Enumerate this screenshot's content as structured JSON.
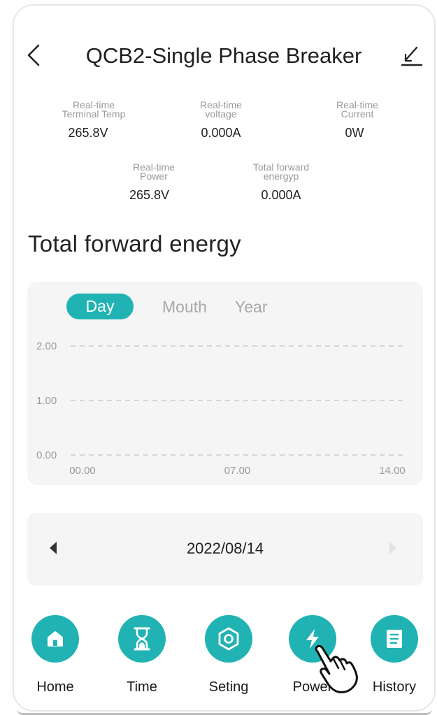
{
  "header": {
    "title": "QCB2-Single Phase Breaker"
  },
  "stats": [
    {
      "label": "Real-time\nTerminal Temp",
      "value": "265.8V"
    },
    {
      "label": "Real-time\nvoltage",
      "value": "0.000A"
    },
    {
      "label": "Real-time\nCurrent",
      "value": "0W"
    },
    {
      "label": "Real-time\nPower",
      "value": "265.8V"
    },
    {
      "label": "Total forward\nenergyp",
      "value": "0.000A"
    }
  ],
  "section_title": "Total forward energy",
  "tabs": [
    {
      "label": "Day",
      "active": true
    },
    {
      "label": "Mouth",
      "active": false
    },
    {
      "label": "Year",
      "active": false
    }
  ],
  "chart_data": {
    "type": "line",
    "title": "",
    "xlabel": "",
    "ylabel": "",
    "x_ticks": [
      "00.00",
      "07.00",
      "14.00"
    ],
    "y_ticks": [
      "0.00",
      "1.00",
      "2.00"
    ],
    "ylim": [
      0,
      2
    ],
    "grid": true,
    "series": []
  },
  "date_nav": {
    "date": "2022/08/14"
  },
  "nav": {
    "items": [
      {
        "label": "Home",
        "icon": "home-icon"
      },
      {
        "label": "Time",
        "icon": "hourglass-icon"
      },
      {
        "label": "Seting",
        "icon": "settings-hexagon-icon"
      },
      {
        "label": "Power",
        "icon": "lightning-icon"
      },
      {
        "label": "History",
        "icon": "document-icon"
      }
    ]
  },
  "colors": {
    "accent": "#21b3b3",
    "card": "#f5f5f5",
    "muted": "#9a9a9a"
  }
}
